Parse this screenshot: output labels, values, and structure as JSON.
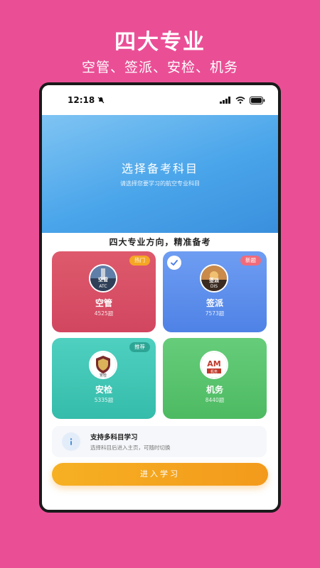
{
  "promo": {
    "title": "四大专业",
    "subtitle": "空管、签派、安检、机务"
  },
  "status_bar": {
    "time": "12:18"
  },
  "hero": {
    "title": "选择备考科目",
    "subtitle": "请选择您要学习的航空专业科目"
  },
  "section": {
    "title": "四大专业方向，精准备考"
  },
  "cards": [
    {
      "name": "空管",
      "count": "4525题",
      "badge": "热门",
      "badge_color": "#f5a623",
      "avatar_text_top": "空管",
      "avatar_text_bottom": "ATC"
    },
    {
      "name": "签派",
      "count": "7573题",
      "badge": "新题",
      "badge_color": "#f06b7a",
      "selected": true,
      "avatar_text_top": "签派",
      "avatar_text_bottom": "DIS"
    },
    {
      "name": "安检",
      "count": "5335题",
      "badge": "推荐",
      "badge_color": "#3bb3a3",
      "avatar_text": "安检"
    },
    {
      "name": "机务",
      "count": "8440题",
      "avatar_text": "机务",
      "logo_text": "AM"
    }
  ],
  "info": {
    "title": "支持多科目学习",
    "description": "选择科目后进入主页，可随时切换",
    "icon": "info-icon"
  },
  "enter_button": {
    "label": "进入学习"
  },
  "colors": {
    "background": "#ea4f96",
    "accent": "#f6b022"
  }
}
